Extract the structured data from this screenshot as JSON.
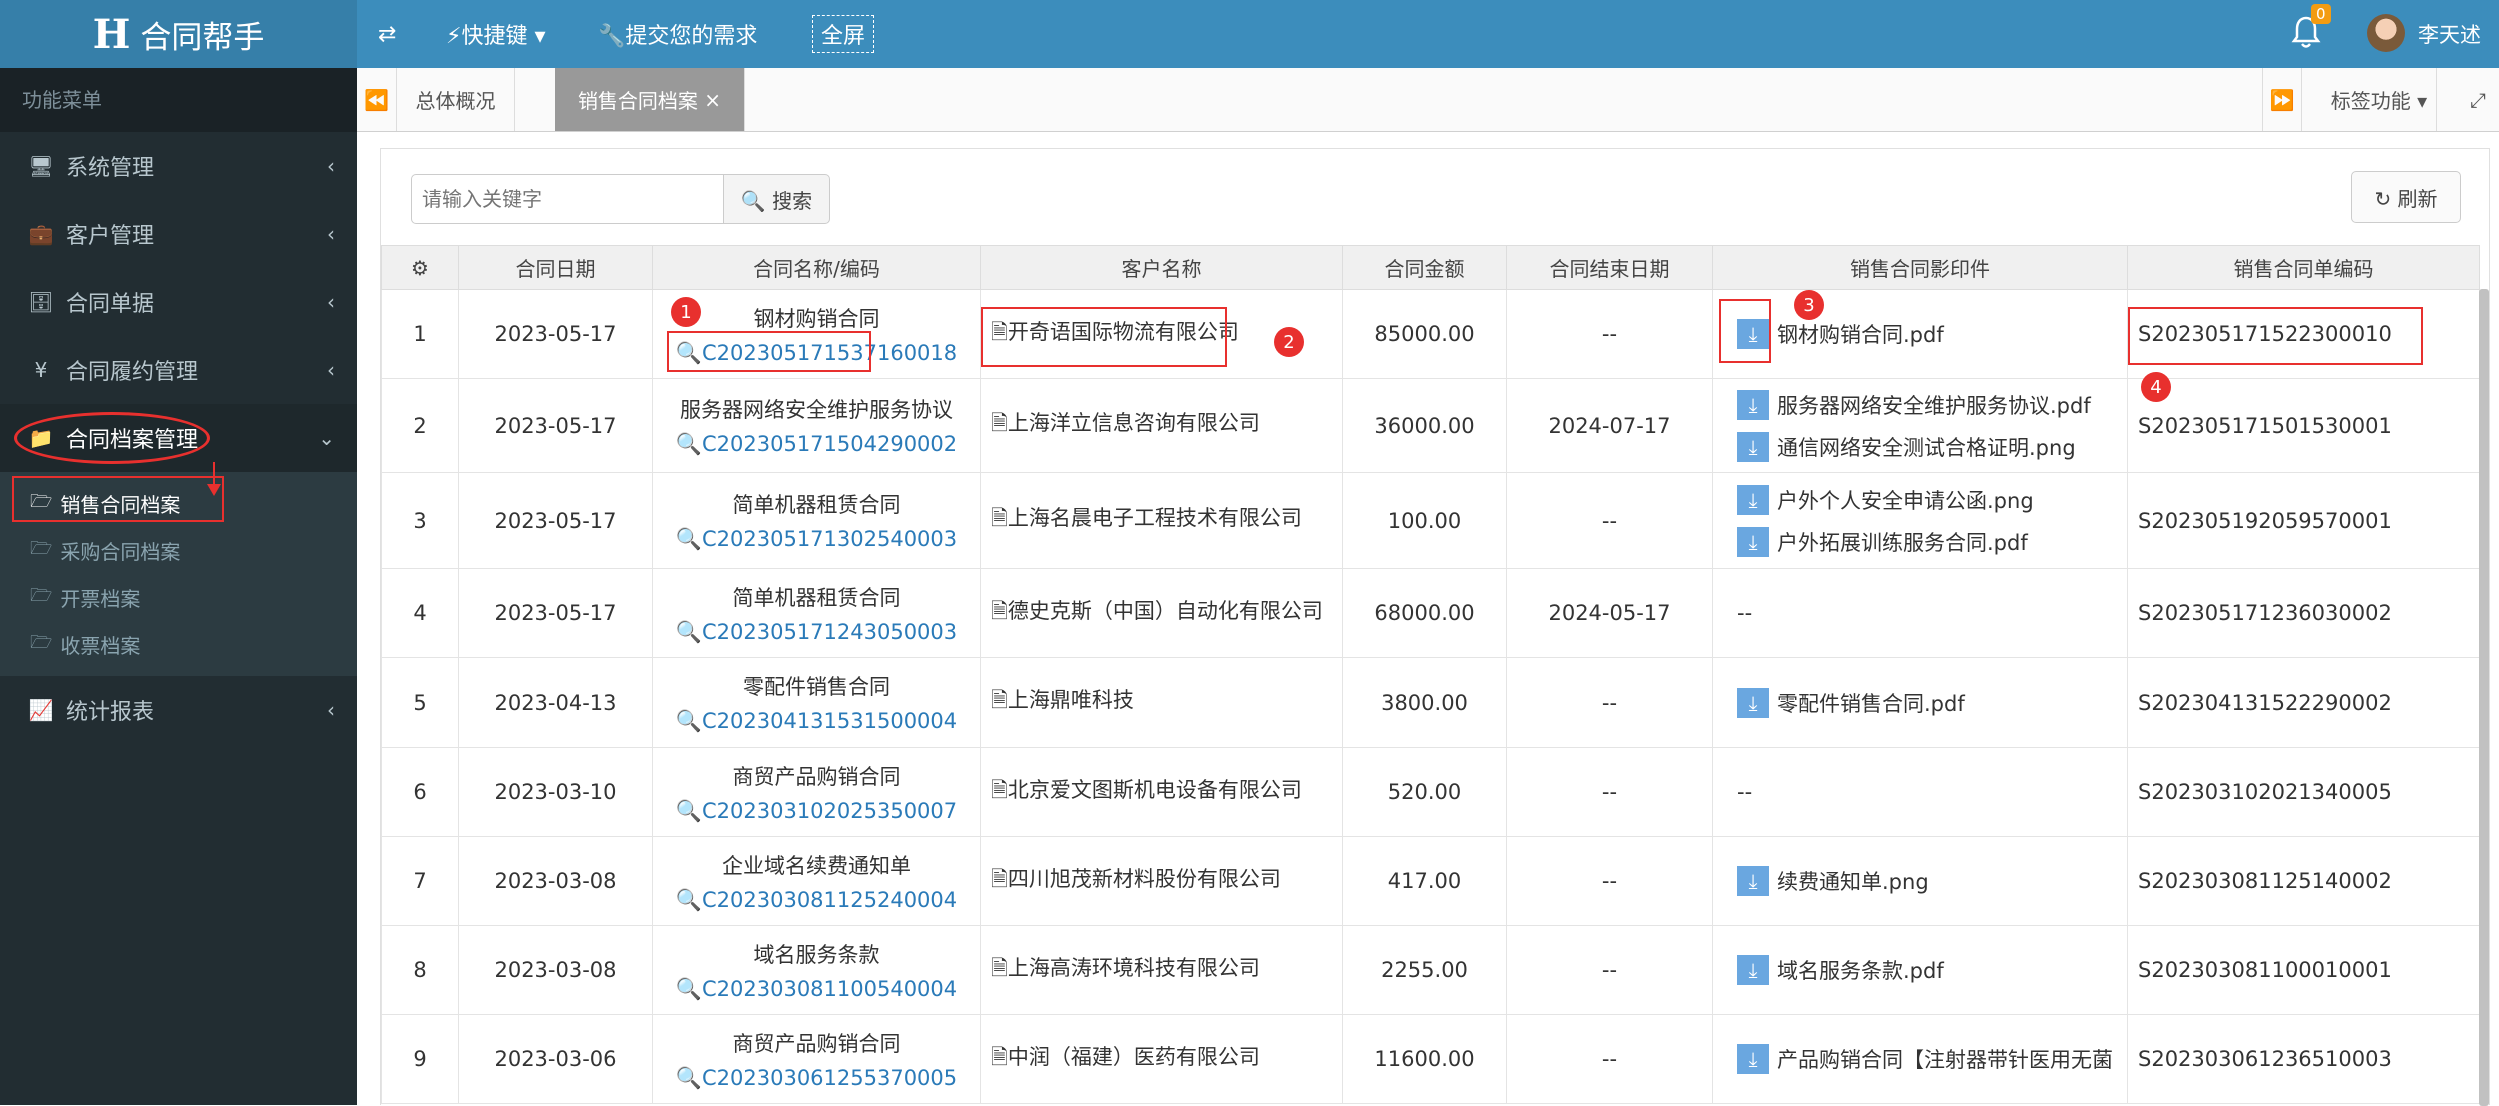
{
  "app": {
    "logo_mark": "H",
    "title": "合同帮手"
  },
  "topbar": {
    "toggle_icon": "⇄",
    "shortcut": "⚡快捷键 ▾",
    "request": "🔧提交您的需求",
    "fullscreen": "全屏",
    "bell_badge": "0",
    "username": "李天述"
  },
  "sidebar": {
    "header": "功能菜单",
    "items": [
      {
        "icon": "🖥",
        "label": "系统管理"
      },
      {
        "icon": "💼",
        "label": "客户管理"
      },
      {
        "icon": "🗄",
        "label": "合同单据"
      },
      {
        "icon": "¥",
        "label": "合同履约管理"
      },
      {
        "icon": "📁",
        "label": "合同档案管理"
      },
      {
        "icon": "📈",
        "label": "统计报表"
      }
    ],
    "submenu": [
      "销售合同档案",
      "采购合同档案",
      "开票档案",
      "收票档案"
    ]
  },
  "tabs": {
    "items": [
      "总体概况",
      "销售合同档案"
    ],
    "close": "×",
    "right_label": "标签功能 ▾"
  },
  "toolbar": {
    "search_placeholder": "请输入关键字",
    "search_label": "🔍 搜索",
    "refresh_label": "↻ 刷新"
  },
  "table": {
    "headers": [
      "⚙",
      "合同日期",
      "合同名称/编码",
      "客户名称",
      "合同金额",
      "合同结束日期",
      "销售合同影印件",
      "销售合同单编码"
    ],
    "rows": [
      {
        "idx": "1",
        "date": "2023-05-17",
        "name": "钢材购销合同",
        "code": "C202305171537160018",
        "customer": "开奇语国际物流有限公司",
        "amount": "85000.00",
        "end": "--",
        "end_red": false,
        "files": [
          "钢材购销合同.pdf"
        ],
        "sales_code": "S202305171522300010"
      },
      {
        "idx": "2",
        "date": "2023-05-17",
        "name": "服务器网络安全维护服务协议",
        "code": "C202305171504290002",
        "customer": "上海洋立信息咨询有限公司",
        "amount": "36000.00",
        "end": "2024-07-17",
        "end_red": true,
        "files": [
          "服务器网络安全维护服务协议.pdf",
          "通信网络安全测试合格证明.png"
        ],
        "sales_code": "S202305171501530001"
      },
      {
        "idx": "3",
        "date": "2023-05-17",
        "name": "简单机器租赁合同",
        "code": "C202305171302540003",
        "customer": "上海名晨电子工程技术有限公司",
        "amount": "100.00",
        "end": "--",
        "end_red": false,
        "files": [
          "户外个人安全申请公函.png",
          "户外拓展训练服务合同.pdf"
        ],
        "sales_code": "S202305192059570001"
      },
      {
        "idx": "4",
        "date": "2023-05-17",
        "name": "简单机器租赁合同",
        "code": "C202305171243050003",
        "customer": "德史克斯（中国）自动化有限公司",
        "amount": "68000.00",
        "end": "2024-05-17",
        "end_red": true,
        "files": [],
        "sales_code": "S202305171236030002"
      },
      {
        "idx": "5",
        "date": "2023-04-13",
        "name": "零配件销售合同",
        "code": "C202304131531500004",
        "customer": "上海鼎唯科技",
        "amount": "3800.00",
        "end": "--",
        "end_red": false,
        "files": [
          "零配件销售合同.pdf"
        ],
        "sales_code": "S202304131522290002"
      },
      {
        "idx": "6",
        "date": "2023-03-10",
        "name": "商贸产品购销合同",
        "code": "C202303102025350007",
        "customer": "北京爱文图斯机电设备有限公司",
        "amount": "520.00",
        "end": "--",
        "end_red": false,
        "files": [],
        "sales_code": "S202303102021340005"
      },
      {
        "idx": "7",
        "date": "2023-03-08",
        "name": "企业域名续费通知单",
        "code": "C202303081125240004",
        "customer": "四川旭茂新材料股份有限公司",
        "amount": "417.00",
        "end": "--",
        "end_red": false,
        "files": [
          "续费通知单.png"
        ],
        "sales_code": "S202303081125140002"
      },
      {
        "idx": "8",
        "date": "2023-03-08",
        "name": "域名服务条款",
        "code": "C202303081100540004",
        "customer": "上海高涛环境科技有限公司",
        "amount": "2255.00",
        "end": "--",
        "end_red": false,
        "files": [
          "域名服务条款.pdf"
        ],
        "sales_code": "S202303081100010001"
      },
      {
        "idx": "9",
        "date": "2023-03-06",
        "name": "商贸产品购销合同",
        "code": "C202303061255370005",
        "customer": "中润（福建）医药有限公司",
        "amount": "11600.00",
        "end": "--",
        "end_red": false,
        "files": [
          "产品购销合同【注射器带针医用无菌"
        ],
        "sales_code": "S202303061236510003"
      }
    ],
    "empty_files": "--"
  },
  "annotations": [
    "1",
    "2",
    "3",
    "4"
  ],
  "colors": {
    "topbar": "#3c8dbc",
    "sidebar": "#222d32",
    "link": "#2a7ab8",
    "red": "#e8302e"
  }
}
